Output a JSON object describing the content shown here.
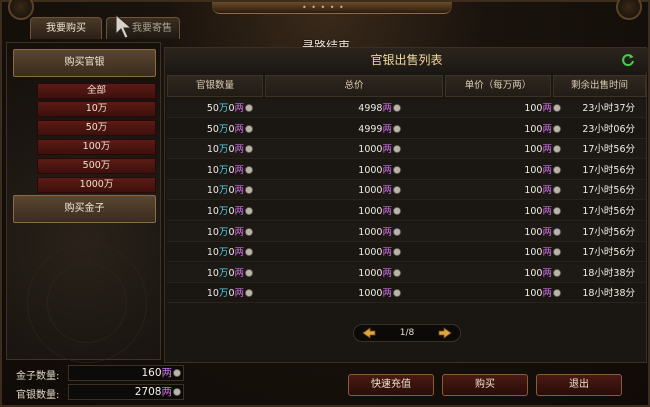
{
  "tabs": {
    "buy": "我要购买",
    "sell": "我要寄售"
  },
  "overlay_text": "寻路结束",
  "left": {
    "buy_silver": "购买官银",
    "amounts": [
      "全部",
      "10万",
      "50万",
      "100万",
      "500万",
      "1000万"
    ],
    "buy_gold": "购买金子"
  },
  "panel": {
    "title": "官银出售列表",
    "columns": [
      "官银数量",
      "总价",
      "单价（每万两）",
      "剩余出售时间"
    ]
  },
  "rows": [
    {
      "qty": "50",
      "total": "4998",
      "unit_price": "100",
      "time": "23小时37分"
    },
    {
      "qty": "50",
      "total": "4999",
      "unit_price": "100",
      "time": "23小时06分"
    },
    {
      "qty": "10",
      "total": "1000",
      "unit_price": "100",
      "time": "17小时56分"
    },
    {
      "qty": "10",
      "total": "1000",
      "unit_price": "100",
      "time": "17小时56分"
    },
    {
      "qty": "10",
      "total": "1000",
      "unit_price": "100",
      "time": "17小时56分"
    },
    {
      "qty": "10",
      "total": "1000",
      "unit_price": "100",
      "time": "17小时56分"
    },
    {
      "qty": "10",
      "total": "1000",
      "unit_price": "100",
      "time": "17小时56分"
    },
    {
      "qty": "10",
      "total": "1000",
      "unit_price": "100",
      "time": "17小时56分"
    },
    {
      "qty": "10",
      "total": "1000",
      "unit_price": "100",
      "time": "18小时38分"
    },
    {
      "qty": "10",
      "total": "1000",
      "unit_price": "100",
      "time": "18小时38分"
    }
  ],
  "units": {
    "wan": "万",
    "zero": "0",
    "liang": "两"
  },
  "pager": {
    "text": "1/8"
  },
  "resources": {
    "gold_label": "金子数量:",
    "gold_value": "160",
    "silver_label": "官银数量:",
    "silver_value": "2708"
  },
  "buttons": {
    "recharge": "快速充值",
    "buy": "购买",
    "exit": "退出"
  },
  "colors": {
    "wan_unit": "#4fd0e8",
    "liang_unit": "#cd6ee6",
    "panel_title": "#f2d9a0"
  }
}
